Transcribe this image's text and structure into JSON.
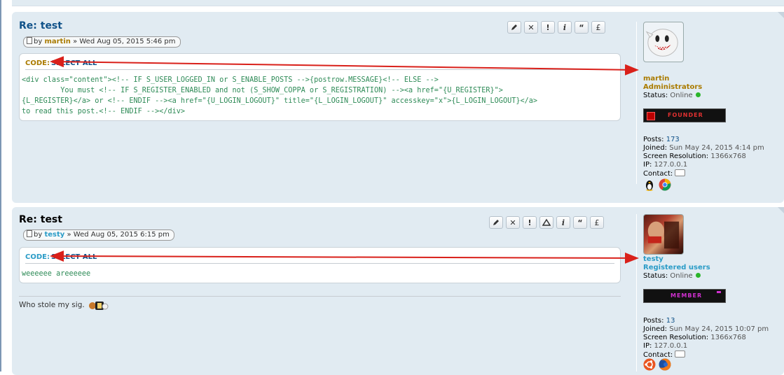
{
  "post1": {
    "title": "Re: test",
    "by": "by",
    "author": "martin",
    "date": "» Wed Aug 05, 2015 5:46 pm",
    "code_label": "CODE:",
    "select_all": "SELECT ALL",
    "code_lines": [
      "<div class=\"content\"><!-- IF S_USER_LOGGED_IN or S_ENABLE_POSTS -->{postrow.MESSAGE}<!-- ELSE -->",
      "         You must <!-- IF S_REGISTER_ENABLED and not (S_SHOW_COPPA or S_REGISTRATION) --><a href=\"{U_REGISTER}\">",
      "{L_REGISTER}</a> or <!-- ENDIF --><a href=\"{U_LOGIN_LOGOUT}\" title=\"{L_LOGIN_LOGOUT}\" accesskey=\"x\">{L_LOGIN_LOGOUT}</a>",
      "to read this post.<!-- ENDIF --></div>"
    ],
    "profile": {
      "username": "martin",
      "rank": "Administrators",
      "status_label": "Status:",
      "status_value": "Online",
      "rank_image_text": "FOUNDER",
      "posts_label": "Posts:",
      "posts_value": "173",
      "joined_label": "Joined:",
      "joined_value": "Sun May 24, 2015 4:14 pm",
      "resolution_label": "Screen Resolution:",
      "resolution_value": "1366x768",
      "ip_label": "IP:",
      "ip_value": "127.0.0.1",
      "contact_label": "Contact:"
    },
    "buttons": [
      "edit-icon",
      "delete-icon",
      "report-icon",
      "info-icon",
      "quote-icon",
      "pound-icon"
    ]
  },
  "post2": {
    "title": "Re: test",
    "by": "by",
    "author": "testy",
    "date": "» Wed Aug 05, 2015 6:15 pm",
    "code_label": "CODE:",
    "select_all": "SELECT ALL",
    "code_lines": [
      "weeeeee areeeeee"
    ],
    "signature": "Who stole my sig.",
    "profile": {
      "username": "testy",
      "rank": "Registered users",
      "status_label": "Status:",
      "status_value": "Online",
      "rank_image_text": "MEMBER",
      "posts_label": "Posts:",
      "posts_value": "13",
      "joined_label": "Joined:",
      "joined_value": "Sun May 24, 2015 10:07 pm",
      "resolution_label": "Screen Resolution:",
      "resolution_value": "1366x768",
      "ip_label": "IP:",
      "ip_value": "127.0.0.1",
      "contact_label": "Contact:"
    },
    "buttons": [
      "edit-icon",
      "delete-icon",
      "report-icon",
      "warn-icon",
      "info-icon",
      "quote-icon",
      "pound-icon"
    ]
  },
  "colors": {
    "post_bg": "#e1ebf2",
    "admin_color": "#aa7b00",
    "registered_color": "#2b9cc7",
    "link_color": "#105289",
    "code_color": "#2e8b57",
    "arrow_color": "#d9201a"
  }
}
